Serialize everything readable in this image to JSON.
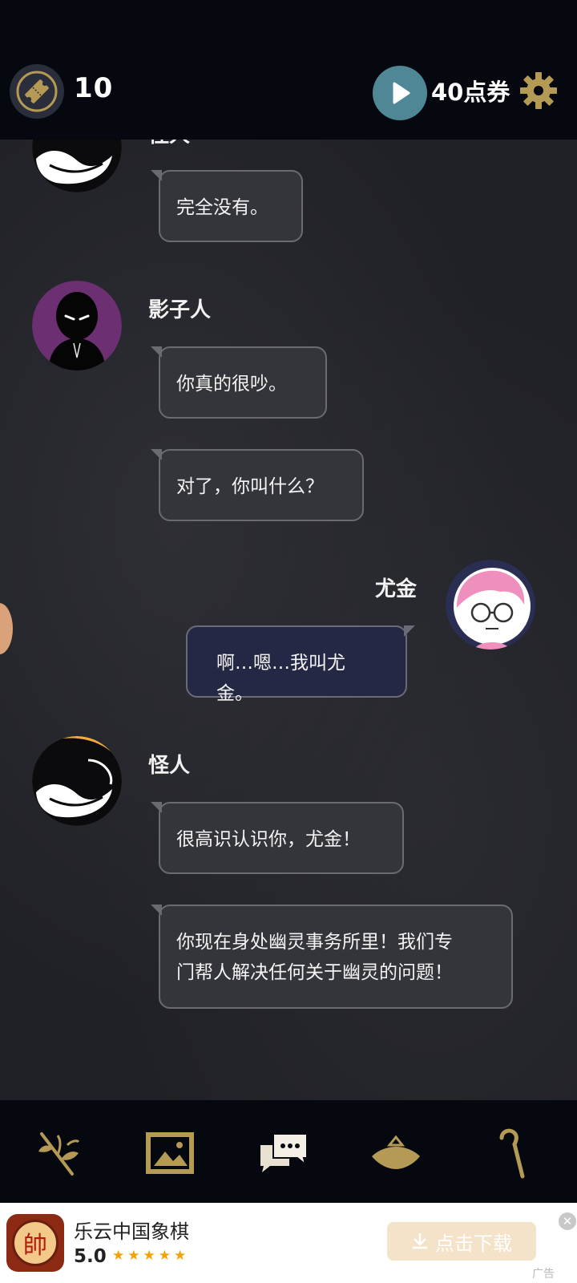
{
  "header": {
    "tickets_count": "10",
    "coupon_label": "40点券"
  },
  "messages": [
    {
      "speaker": "怪人",
      "text": "完全没有。"
    },
    {
      "speaker": "影子人",
      "text": "你真的很吵。"
    },
    {
      "speaker": "",
      "text": "对了，你叫什么？"
    },
    {
      "speaker": "尤金",
      "text": "啊…嗯…我叫尤金。"
    },
    {
      "speaker": "怪人",
      "text": "很高识认识你，尤金！"
    },
    {
      "speaker": "",
      "lines": [
        "你现在身处幽灵事务所里！我们专",
        "门帮人解决任何关于幽灵的问题！"
      ]
    }
  ],
  "icons": {
    "ticket": "ticket-icon",
    "video": "play-icon",
    "settings": "gear-icon",
    "nav": [
      "herb-icon",
      "gallery-icon",
      "chat-icon",
      "fan-icon",
      "cane-icon"
    ]
  },
  "ad": {
    "title": "乐云中国象棋",
    "rating": "5.0",
    "icon_char": "帥",
    "download_label": "点击下载",
    "ad_label": "广告",
    "close_glyph": "✕"
  },
  "colors": {
    "accent_gold": "#b59a55",
    "video_teal": "#4f8796",
    "bubble_user": "#242844"
  }
}
